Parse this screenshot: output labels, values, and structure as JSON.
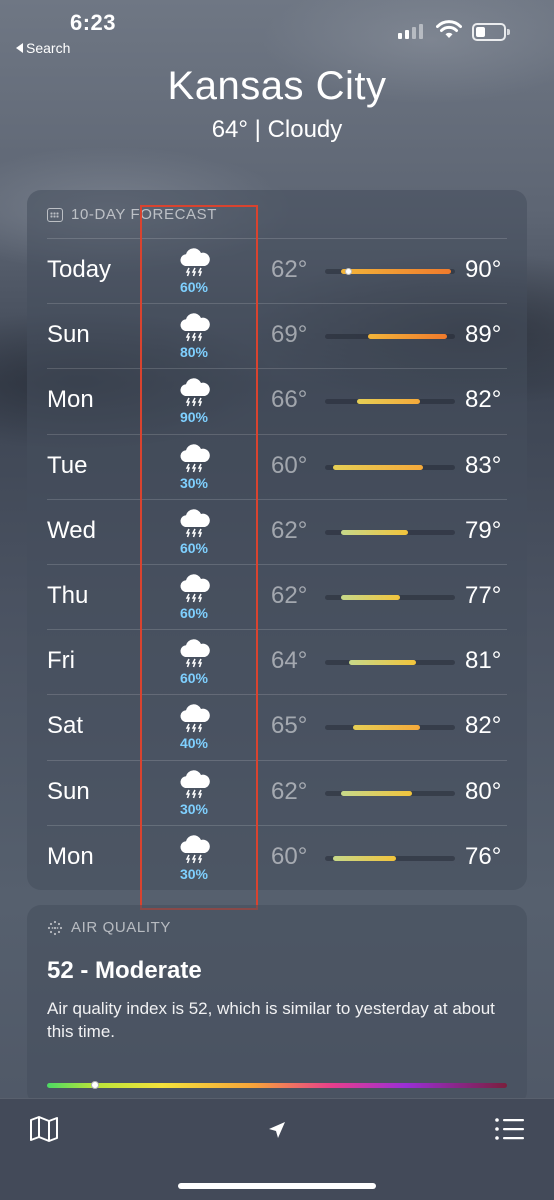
{
  "status_bar": {
    "time": "6:23",
    "back_label": "Search"
  },
  "header": {
    "city": "Kansas City",
    "current": "64°  |  Cloudy"
  },
  "forecast": {
    "title": "10-DAY FORECAST",
    "days": [
      {
        "day": "Today",
        "chance": "60%",
        "low": "62°",
        "high": "90°",
        "low_num": 62,
        "high_num": 90,
        "current": 64
      },
      {
        "day": "Sun",
        "chance": "80%",
        "low": "69°",
        "high": "89°",
        "low_num": 69,
        "high_num": 89
      },
      {
        "day": "Mon",
        "chance": "90%",
        "low": "66°",
        "high": "82°",
        "low_num": 66,
        "high_num": 82
      },
      {
        "day": "Tue",
        "chance": "30%",
        "low": "60°",
        "high": "83°",
        "low_num": 60,
        "high_num": 83
      },
      {
        "day": "Wed",
        "chance": "60%",
        "low": "62°",
        "high": "79°",
        "low_num": 62,
        "high_num": 79
      },
      {
        "day": "Thu",
        "chance": "60%",
        "low": "62°",
        "high": "77°",
        "low_num": 62,
        "high_num": 77
      },
      {
        "day": "Fri",
        "chance": "60%",
        "low": "64°",
        "high": "81°",
        "low_num": 64,
        "high_num": 81
      },
      {
        "day": "Sat",
        "chance": "40%",
        "low": "65°",
        "high": "82°",
        "low_num": 65,
        "high_num": 82
      },
      {
        "day": "Sun",
        "chance": "30%",
        "low": "62°",
        "high": "80°",
        "low_num": 62,
        "high_num": 80
      },
      {
        "day": "Mon",
        "chance": "30%",
        "low": "60°",
        "high": "76°",
        "low_num": 60,
        "high_num": 76
      }
    ],
    "range_min": 58,
    "range_max": 91,
    "icon": "thunderstorm-cloud-icon"
  },
  "air_quality": {
    "title": "AIR QUALITY",
    "value": "52 - Moderate",
    "description": "Air quality index is 52, which is similar to yesterday at about this time.",
    "index": 52,
    "scale_max": 500
  },
  "colors": {
    "precip": "#7fd0ff",
    "highlight": "#d9432f"
  }
}
